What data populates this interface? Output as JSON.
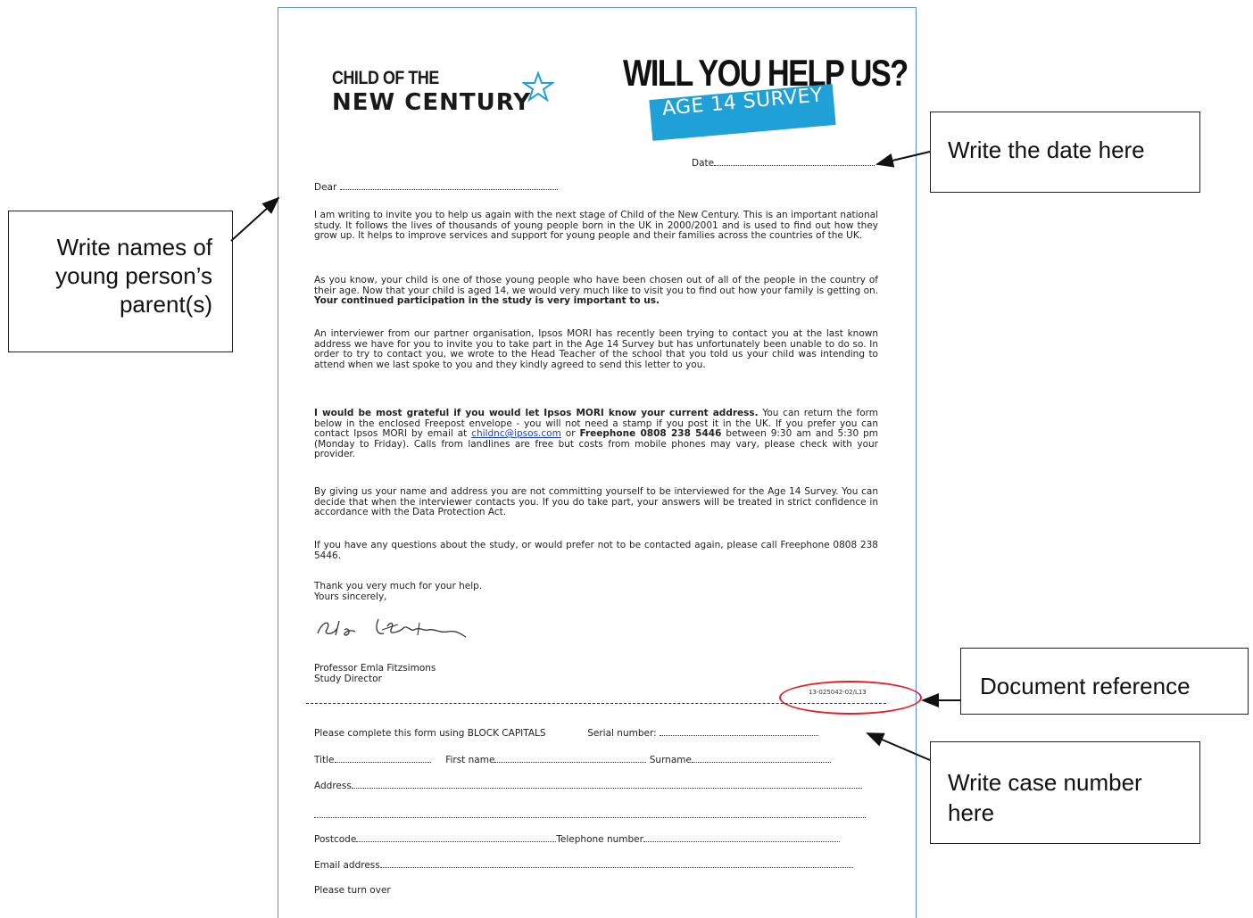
{
  "letter": {
    "logo_line1": "CHILD OF THE",
    "logo_line2": "NEW CENTURY",
    "headline": "WILL YOU HELP US?",
    "badge": "AGE 14 SURVEY",
    "date_label": "Date",
    "salutation": "Dear",
    "para1": "I am writing to invite you to help us again with the next stage of Child of the New Century. This is an important national study. It follows the lives of thousands of young people born in the UK in 2000/2001 and is used to find out how they grow up. It helps to improve services and support for young people and their families across the countries of the UK.",
    "para2_a": "As you know, your child is one of those young people who have been chosen out of all of the people in the country of their age. Now that your child is aged 14, we would very much like to visit you to find out how your family is getting on. ",
    "para2_b": "Your continued participation in the study is very important to us.",
    "para3": "An interviewer from our partner organisation, Ipsos MORI has recently been trying to contact you at the last known address we have for you to invite you to take part in the Age 14 Survey but has unfortunately been unable to do so. In order to try to contact you, we wrote to the Head Teacher of the school that you told us your child was intending to attend when we last spoke to you and they kindly agreed to send this letter to you.",
    "para4_bold": "I would be most grateful if you would let Ipsos MORI know your current address.",
    "para4_a": " You can return the form below in the enclosed Freepost envelope - you will not need a stamp if you post it in the UK. If you prefer you can contact Ipsos MORI by email at ",
    "para4_email": "childnc@ipsos.com",
    "para4_or": " or ",
    "para4_phone": "Freephone 0808 238 5446",
    "para4_b": " between 9:30 am and 5:30 pm (Monday to Friday). Calls from landlines are free but costs from mobile phones may vary, please check with your provider.",
    "para5": "By giving us your name and address you are not committing yourself to be interviewed for the Age 14 Survey. You can decide that when the interviewer contacts you. If you do take part, your answers will be treated in strict confidence in accordance with the Data Protection Act.",
    "para6": "If you have any questions about the study, or would prefer not to be contacted again, please call Freephone 0808 238 5446.",
    "closing1": "Thank you very much for your help.",
    "closing2": "Yours sincerely,",
    "signer_name": "Professor Emla Fitzsimons",
    "signer_role": "Study Director",
    "doc_ref": "13-025042-02/L13"
  },
  "form": {
    "instruction": "Please complete this form using BLOCK CAPITALS",
    "serial_label": "Serial number:",
    "title_label": "Title",
    "firstname_label": "First name",
    "surname_label": "Surname",
    "address_label": "Address",
    "postcode_label": "Postcode",
    "telephone_label": "Telephone number",
    "email_label": "Email address",
    "turn_over": "Please turn over"
  },
  "callouts": {
    "parents_line1": "Write names of",
    "parents_line2": "young person’s",
    "parents_line3": "parent(s)",
    "date": "Write the date here",
    "doc_ref": "Document reference",
    "case_line1": "Write case number",
    "case_line2": "here"
  },
  "colors": {
    "badge": "#1fa0d6",
    "page_border": "#5b8fd0",
    "oval": "#e0202a",
    "link": "#1a3fd6"
  }
}
